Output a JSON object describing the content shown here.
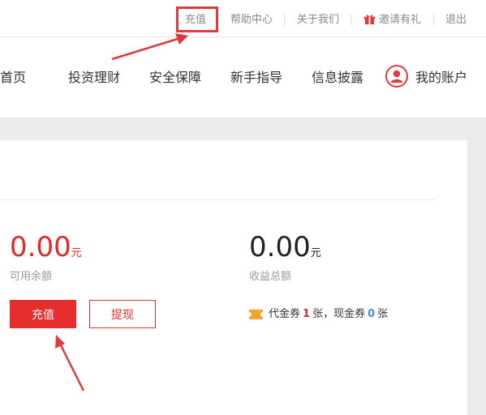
{
  "topbar": {
    "links": [
      "充值",
      "帮助中心",
      "关于我们",
      "邀请有礼",
      "退出"
    ]
  },
  "nav": {
    "items": [
      "首页",
      "投资理财",
      "安全保障",
      "新手指导",
      "信息披露"
    ],
    "account": "我的账户"
  },
  "account_summary": {
    "available_balance": "0.00",
    "available_unit": "元",
    "available_label": "可用余额",
    "total_income": "0.00",
    "income_unit": "元",
    "income_label": "收益总额",
    "recharge_button": "充值",
    "withdraw_button": "提现",
    "coupon": {
      "voucher_label": "代金券",
      "voucher_count": "1",
      "voucher_unit": "张，现金券",
      "cash_count": "0",
      "cash_unit": "张"
    }
  },
  "colors": {
    "accent_red": "#e62e2e",
    "highlight_blue": "#3b8fe0",
    "coupon_orange": "#f3a12f",
    "page_gray": "#ebebeb"
  }
}
